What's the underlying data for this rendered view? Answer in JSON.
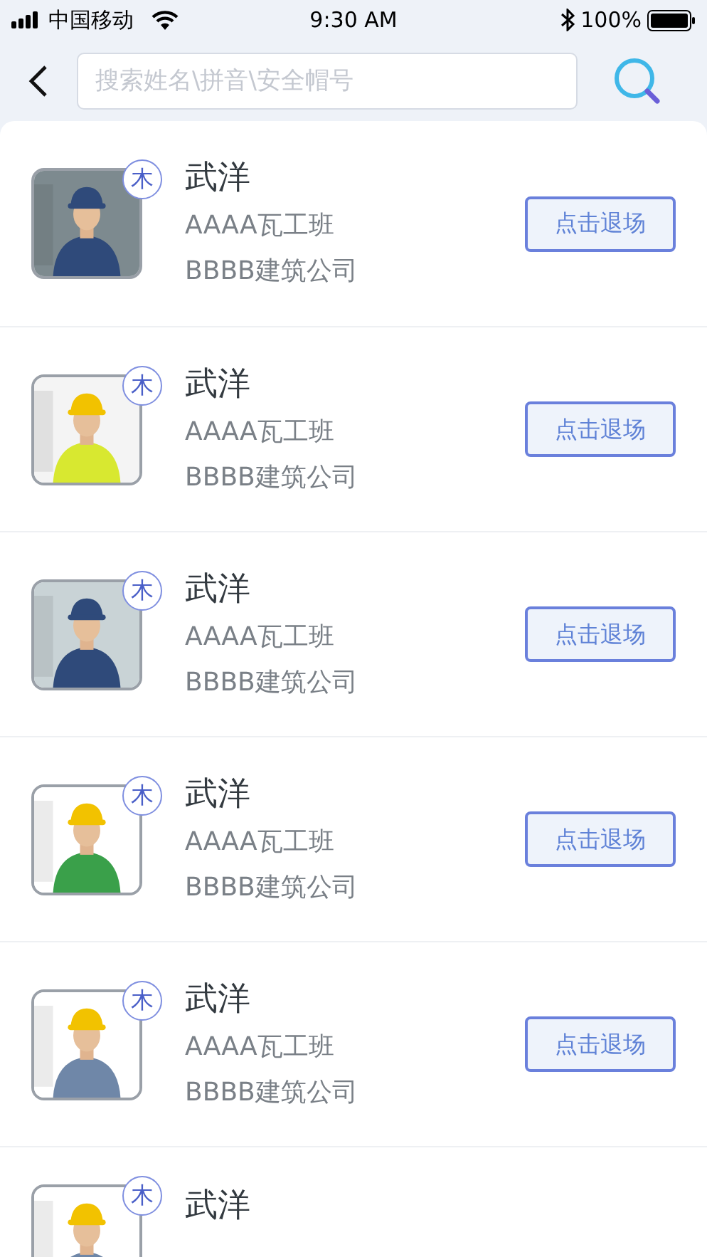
{
  "status_bar": {
    "carrier": "中国移动",
    "time": "9:30 AM",
    "battery": "100%"
  },
  "search": {
    "placeholder": "搜索姓名\\拼音\\安全帽号"
  },
  "workers": [
    {
      "name": "武洋",
      "badge": "木",
      "team": "AAAA瓦工班",
      "company": "BBBB建筑公司",
      "button": "点击退场"
    },
    {
      "name": "武洋",
      "badge": "木",
      "team": "AAAA瓦工班",
      "company": "BBBB建筑公司",
      "button": "点击退场"
    },
    {
      "name": "武洋",
      "badge": "木",
      "team": "AAAA瓦工班",
      "company": "BBBB建筑公司",
      "button": "点击退场"
    },
    {
      "name": "武洋",
      "badge": "木",
      "team": "AAAA瓦工班",
      "company": "BBBB建筑公司",
      "button": "点击退场"
    },
    {
      "name": "武洋",
      "badge": "木",
      "team": "AAAA瓦工班",
      "company": "BBBB建筑公司",
      "button": "点击退场"
    },
    {
      "name": "武洋",
      "badge": "木"
    }
  ]
}
